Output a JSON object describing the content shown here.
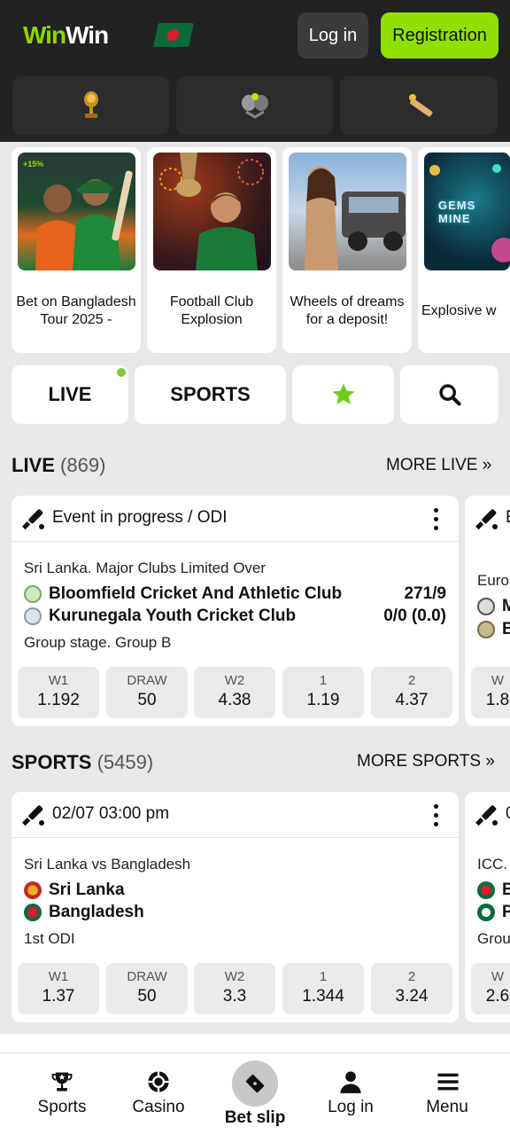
{
  "header": {
    "logo_part1": "Win",
    "logo_part2": "Win",
    "login_label": "Log in",
    "register_label": "Registration"
  },
  "categories": [
    {
      "icon": "trophy-icon"
    },
    {
      "icon": "tennis-icon"
    },
    {
      "icon": "cricket-icon"
    }
  ],
  "promos": [
    {
      "caption": "Bet on Bangladesh Tour 2025 -",
      "badge": "+15%"
    },
    {
      "caption": "Football Club Explosion"
    },
    {
      "caption": "Wheels of dreams for a deposit!"
    },
    {
      "caption": "Explosive w",
      "image_text": "GEMS MINE"
    }
  ],
  "tabs": {
    "live": "LIVE",
    "sports": "SPORTS",
    "favorites_icon": "star-icon",
    "search_icon": "search-icon"
  },
  "live_section": {
    "title": "LIVE",
    "count": "(869)",
    "more": "MORE LIVE"
  },
  "live_card": {
    "header": "Event in progress / ODI",
    "league": "Sri Lanka. Major Clubs Limited Over",
    "team1": "Bloomfield Cricket And Athletic Club",
    "team1_score": "271/9",
    "team2": "Kurunegala Youth Cricket Club",
    "team2_score": "0/0 (0.0)",
    "stage": "Group stage. Group B",
    "odds": [
      {
        "label": "W1",
        "value": "1.192"
      },
      {
        "label": "DRAW",
        "value": "50"
      },
      {
        "label": "W2",
        "value": "4.38"
      },
      {
        "label": "1",
        "value": "1.19"
      },
      {
        "label": "2",
        "value": "4.37"
      }
    ]
  },
  "live_card_peek": {
    "header": "E",
    "league": "Euro",
    "team1": "M",
    "team2": "B",
    "odd_label": "W",
    "odd_value": "1.8"
  },
  "sports_section": {
    "title": "SPORTS",
    "count": "(5459)",
    "more": "MORE SPORTS"
  },
  "sports_card": {
    "header": "02/07 03:00 pm",
    "league": "Sri Lanka vs Bangladesh",
    "team1": "Sri Lanka",
    "team2": "Bangladesh",
    "stage": "1st ODI",
    "odds": [
      {
        "label": "W1",
        "value": "1.37"
      },
      {
        "label": "DRAW",
        "value": "50"
      },
      {
        "label": "W2",
        "value": "3.3"
      },
      {
        "label": "1",
        "value": "1.344"
      },
      {
        "label": "2",
        "value": "3.24"
      }
    ]
  },
  "sports_card_peek": {
    "header": "0",
    "league": "ICC.",
    "team1": "B",
    "team2": "P",
    "stage": "Grou",
    "odd_label": "W",
    "odd_value": "2.6"
  },
  "bottom_nav": [
    {
      "label": "Sports",
      "icon": "trophy-icon"
    },
    {
      "label": "Casino",
      "icon": "casino-chip-icon"
    },
    {
      "label": "Bet slip",
      "icon": "ticket-icon"
    },
    {
      "label": "Log in",
      "icon": "user-icon"
    },
    {
      "label": "Menu",
      "icon": "menu-icon"
    }
  ],
  "colors": {
    "accent": "#8fe000",
    "header_bg": "#222222",
    "live_dot": "#7ccc3a"
  }
}
